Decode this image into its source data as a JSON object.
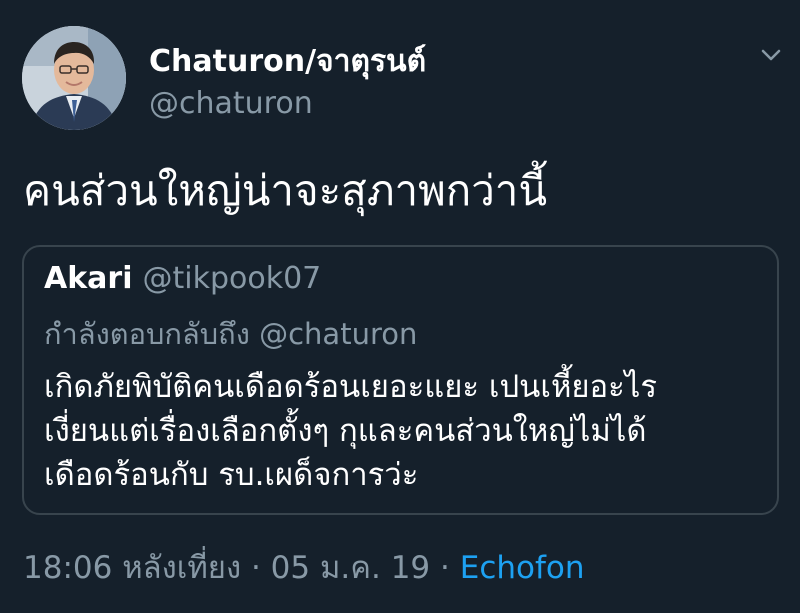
{
  "author": {
    "display_name": "Chaturon/จาตุรนต์",
    "handle": "@chaturon",
    "avatar": "profile-photo"
  },
  "tweet": {
    "text": "คนส่วนใหญ่น่าจะสุภาพกว่านี้"
  },
  "quoted_tweet": {
    "display_name": "Akari",
    "handle": "@tikpook07",
    "reply_context": "กำลังตอบกลับถึง @chaturon",
    "lines": [
      "เกิดภัยพิบัติคนเดือดร้อนเยอะแยะ เปนเหี้ยอะไร",
      "เงี่ยนแต่เรื่องเลือกตั้งๆ  กุและคนส่วนใหญ่ไม่ได้",
      "เดือดร้อนกับ รบ.เผด็จการว่ะ"
    ]
  },
  "meta": {
    "time": "18:06 หลังเที่ยง",
    "separator": "·",
    "date": "05 ม.ค. 19",
    "source": "Echofon"
  },
  "colors": {
    "background": "#15202b",
    "secondary_text": "#8899a6",
    "link": "#1da1f2",
    "border": "#38444d"
  },
  "icons": {
    "caret": "chevron-down-icon"
  }
}
